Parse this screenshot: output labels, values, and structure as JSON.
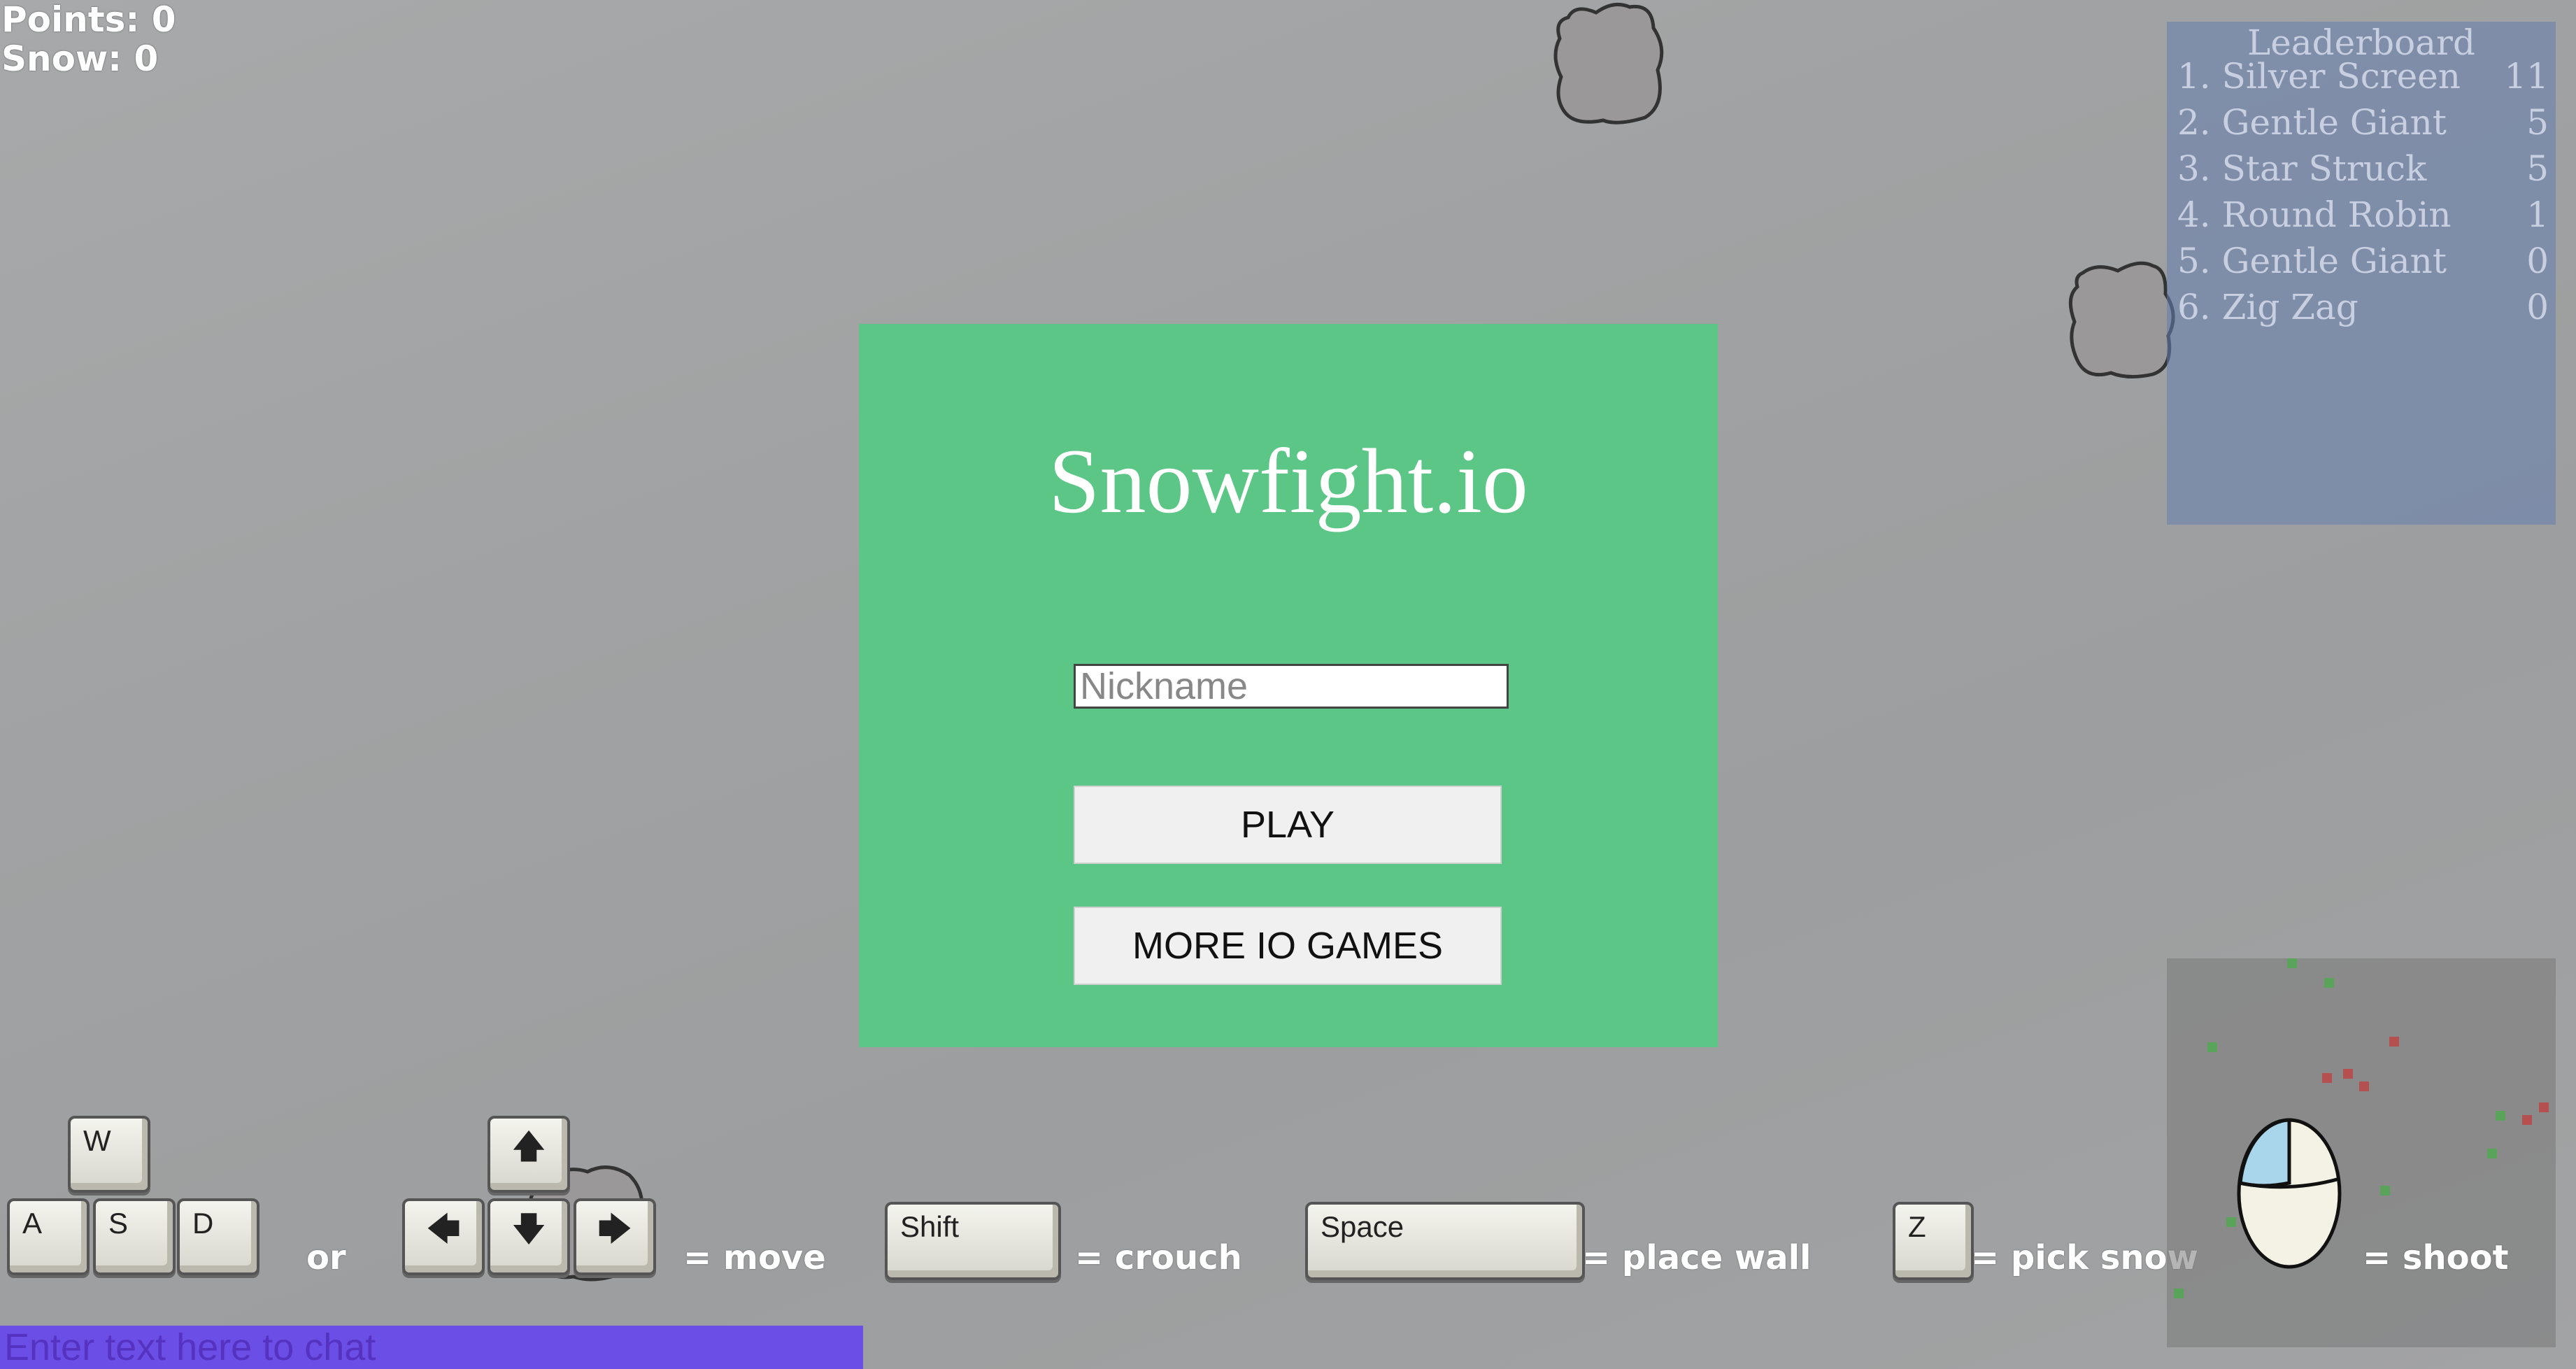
{
  "hud": {
    "points": "Points: 0",
    "snow": "Snow: 0"
  },
  "leaderboard": {
    "title": "Leaderboard",
    "entries": [
      {
        "name": "1. Silver Screen",
        "score": "11"
      },
      {
        "name": "2. Gentle Giant",
        "score": "5"
      },
      {
        "name": "3. Star Struck",
        "score": "5"
      },
      {
        "name": "4. Round Robin",
        "score": "1"
      },
      {
        "name": "5. Gentle Giant",
        "score": "0"
      },
      {
        "name": "6. Zig Zag",
        "score": "0"
      }
    ]
  },
  "menu": {
    "title": "Snowfight.io",
    "nickname_placeholder": "Nickname",
    "play_label": "PLAY",
    "more_label": "MORE IO GAMES"
  },
  "controls": {
    "keys": {
      "w": "W",
      "a": "A",
      "s": "S",
      "d": "D",
      "shift": "Shift",
      "space": "Space",
      "z": "Z"
    },
    "or": "or",
    "move": "= move",
    "crouch": "= crouch",
    "place_wall": "= place wall",
    "pick_snow": "= pick snow",
    "shoot": "= shoot"
  },
  "chat": {
    "placeholder": "Enter text here to chat"
  },
  "colors": {
    "menu_bg": "#5cc686",
    "chat_bg": "#6b4ee6",
    "leaderboard_bg": "#647daf"
  }
}
